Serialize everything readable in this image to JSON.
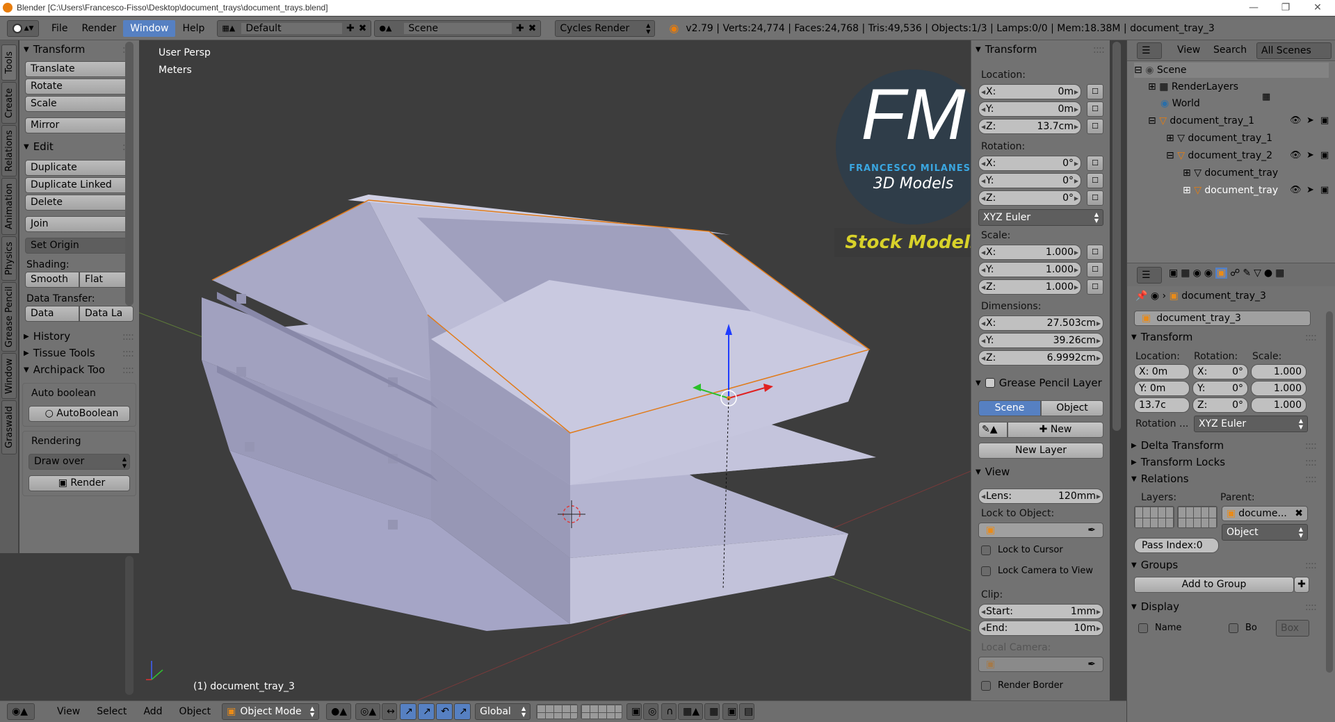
{
  "window": {
    "title": "Blender [C:\\Users\\Francesco-Fisso\\Desktop\\document_trays\\document_trays.blend]"
  },
  "infobar": {
    "menus": [
      "File",
      "Render",
      "Window",
      "Help"
    ],
    "active_menu": "Window",
    "layout": "Default",
    "scene": "Scene",
    "engine": "Cycles Render",
    "stats": "v2.79 | Verts:24,774 | Faces:24,768 | Tris:49,536 | Objects:1/3 | Lamps:0/0 | Mem:18.38M | document_tray_3"
  },
  "tabs": [
    "Tools",
    "Create",
    "Relations",
    "Animation",
    "Physics",
    "Grease Pencil",
    "Window",
    "Graswald"
  ],
  "tools": {
    "transform_header": "Transform",
    "translate": "Translate",
    "rotate": "Rotate",
    "scale": "Scale",
    "mirror": "Mirror",
    "edit_header": "Edit",
    "duplicate": "Duplicate",
    "duplicate_linked": "Duplicate Linked",
    "delete": "Delete",
    "join": "Join",
    "set_origin": "Set Origin",
    "shading_label": "Shading:",
    "smooth": "Smooth",
    "flat": "Flat",
    "data_transfer_label": "Data Transfer:",
    "data": "Data",
    "data_la": "Data La",
    "history": "History",
    "tissue_tools": "Tissue Tools",
    "archipack_tools": "Archipack Too",
    "auto_boolean_label": "Auto boolean",
    "autoboolean_btn": "AutoBoolean",
    "rendering_label": "Rendering",
    "draw_over": "Draw over",
    "render_btn": "Render"
  },
  "viewport": {
    "view_name": "User Persp",
    "units": "Meters",
    "object_label": "(1) document_tray_3",
    "logo_big": "FM",
    "logo_name": "FRANCESCO MILANESE",
    "logo_sub": "3D Models",
    "logo_stock": "Stock Models"
  },
  "npanel": {
    "transform_header": "Transform",
    "location_label": "Location:",
    "loc_x": "0m",
    "loc_y": "0m",
    "loc_z": "13.7cm",
    "rotation_label": "Rotation:",
    "rot_x": "0°",
    "rot_y": "0°",
    "rot_z": "0°",
    "rot_mode": "XYZ Euler",
    "scale_label": "Scale:",
    "scl_x": "1.000",
    "scl_y": "1.000",
    "scl_z": "1.000",
    "dimensions_label": "Dimensions:",
    "dim_x": "27.503cm",
    "dim_y": "39.26cm",
    "dim_z": "6.9992cm",
    "grease_header": "Grease Pencil Layer",
    "gp_scene": "Scene",
    "gp_object": "Object",
    "gp_new": "New",
    "gp_new_layer": "New Layer",
    "view_header": "View",
    "lens_label": "Lens:",
    "lens_val": "120mm",
    "lock_obj_label": "Lock to Object:",
    "lock_cursor": "Lock to Cursor",
    "lock_camera": "Lock Camera to View",
    "clip_label": "Clip:",
    "clip_start_label": "Start:",
    "clip_start": "1mm",
    "clip_end_label": "End:",
    "clip_end": "10m",
    "local_camera": "Local Camera:",
    "render_border": "Render Border",
    "x": "X:",
    "y": "Y:",
    "z": "Z:"
  },
  "outliner": {
    "view": "View",
    "search": "Search",
    "all_scenes": "All Scenes",
    "rows": [
      "Scene",
      "RenderLayers",
      "World",
      "document_tray_1",
      "document_tray_1",
      "document_tray_2",
      "document_tray",
      "document_tray"
    ]
  },
  "properties": {
    "breadcrumb": "document_tray_3",
    "object_name": "document_tray_3",
    "transform_header": "Transform",
    "location_label": "Location:",
    "rotation_label": "Rotation:",
    "scale_label": "Scale:",
    "loc_x": "X: 0m",
    "loc_y": "Y: 0m",
    "loc_z": "13.7c",
    "rot_x": "X:",
    "rot_x_val": "0°",
    "rot_y": "Y:",
    "rot_y_val": "0°",
    "rot_z": "Z:",
    "rot_z_val": "0°",
    "scl_x": "1.000",
    "scl_y": "1.000",
    "scl_z": "1.000",
    "rotation_mode_label": "Rotation ...",
    "rotation_mode": "XYZ Euler",
    "delta_transform": "Delta Transform",
    "transform_locks": "Transform Locks",
    "relations": "Relations",
    "layers_label": "Layers:",
    "parent_label": "Parent:",
    "parent_value": "docume...",
    "parent_type": "Object",
    "pass_index": "Pass Index:0",
    "groups": "Groups",
    "add_to_group": "Add to Group",
    "display": "Display",
    "name_label": "Name",
    "bo_label": "Bo",
    "box_label": "Box"
  },
  "header3d": {
    "view": "View",
    "select": "Select",
    "add": "Add",
    "object": "Object",
    "mode": "Object Mode",
    "orientation": "Global"
  }
}
